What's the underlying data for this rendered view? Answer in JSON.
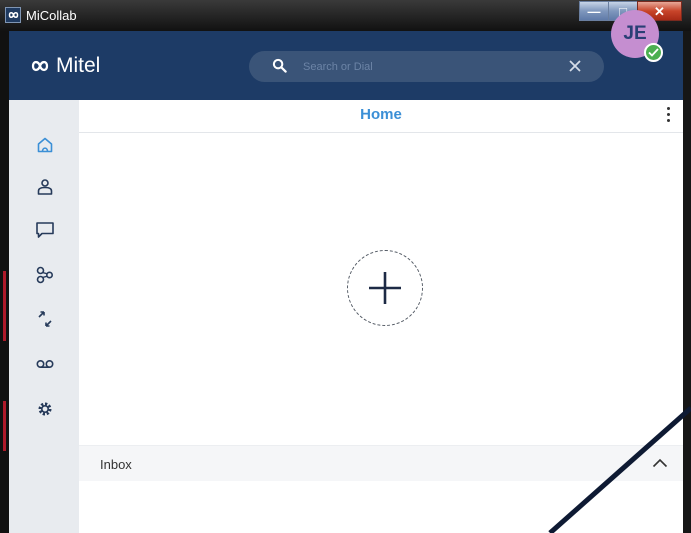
{
  "window": {
    "title": "MiCollab",
    "controls": {
      "minimize_icon": "minimize-icon",
      "maximize_icon": "maximize-icon",
      "close_icon": "close-icon"
    }
  },
  "header": {
    "brand": "Mitel",
    "search": {
      "placeholder": "Search or Dial",
      "value": ""
    },
    "avatar": {
      "initials": "JE",
      "status": "available"
    }
  },
  "sidebar": {
    "items": [
      {
        "id": "home",
        "icon": "home-icon",
        "active": true
      },
      {
        "id": "contacts",
        "icon": "contacts-icon",
        "active": false
      },
      {
        "id": "chat",
        "icon": "chat-icon",
        "active": false
      },
      {
        "id": "teams",
        "icon": "teams-icon",
        "active": false
      },
      {
        "id": "calls",
        "icon": "call-history-icon",
        "active": false
      },
      {
        "id": "voicemail",
        "icon": "voicemail-icon",
        "active": false
      },
      {
        "id": "settings",
        "icon": "gear-icon",
        "active": false
      }
    ]
  },
  "main": {
    "title": "Home",
    "add_icon": "plus-icon",
    "inbox": {
      "label": "Inbox",
      "expanded": true
    }
  },
  "colors": {
    "header_bg": "#1d3b66",
    "accent": "#3b8fd6",
    "avatar_bg": "#c58ed0",
    "presence": "#4caf50",
    "sidebar_bg": "#e8ebef"
  }
}
